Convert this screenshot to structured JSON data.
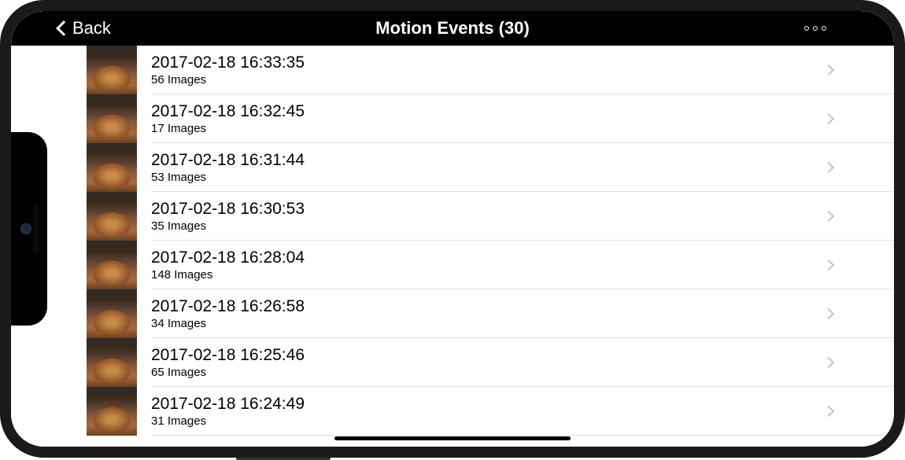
{
  "header": {
    "back_label": "Back",
    "title": "Motion Events (30)"
  },
  "events": [
    {
      "timestamp": "2017-02-18 16:33:35",
      "images_label": "56 Images"
    },
    {
      "timestamp": "2017-02-18 16:32:45",
      "images_label": "17 Images"
    },
    {
      "timestamp": "2017-02-18 16:31:44",
      "images_label": "53 Images"
    },
    {
      "timestamp": "2017-02-18 16:30:53",
      "images_label": "35 Images"
    },
    {
      "timestamp": "2017-02-18 16:28:04",
      "images_label": "148 Images"
    },
    {
      "timestamp": "2017-02-18 16:26:58",
      "images_label": "34 Images"
    },
    {
      "timestamp": "2017-02-18 16:25:46",
      "images_label": "65 Images"
    },
    {
      "timestamp": "2017-02-18 16:24:49",
      "images_label": "31 Images"
    }
  ]
}
